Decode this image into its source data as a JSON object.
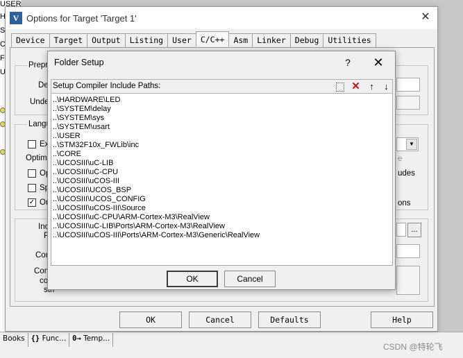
{
  "ide": {
    "project_fragment": "USER",
    "left_letters": [
      "H",
      "S",
      "C",
      "F",
      "U"
    ],
    "bottom_tabs": [
      {
        "icon": "",
        "label": "Books"
      },
      {
        "icon": "{}",
        "label": "Func..."
      },
      {
        "icon": "0→",
        "label": "Temp..."
      }
    ],
    "watermark": "CSDN @特轮飞"
  },
  "options_dialog": {
    "title": "Options for Target 'Target 1'",
    "tabs": [
      "Device",
      "Target",
      "Output",
      "Listing",
      "User",
      "C/C++",
      "Asm",
      "Linker",
      "Debug",
      "Utilities"
    ],
    "active_tab": "C/C++",
    "partial_labels": {
      "preprocessor": "Preproc",
      "define": "Def",
      "undefine": "Undef",
      "language": "Langu",
      "execute_only": "Ex",
      "optimization": "Optimiz",
      "opt1": "Op",
      "opt2": "Sp",
      "opt3": "On",
      "include": "Inclu",
      "paths": "Path",
      "misc": "M",
      "controls": "Contr",
      "compiler": "Comp",
      "control": "cont",
      "string": "stri",
      "right_e": "e",
      "right_udes": "udes",
      "right_ons": "ons"
    },
    "browse_button": "...",
    "buttons": {
      "ok": "OK",
      "cancel": "Cancel",
      "defaults": "Defaults",
      "help": "Help"
    }
  },
  "folder_setup": {
    "title": "Folder Setup",
    "help_symbol": "?",
    "close_symbol": "✕",
    "caption": "Setup Compiler Include Paths:",
    "tools": {
      "new": "",
      "delete": "✕",
      "up": "↑",
      "down": "↓"
    },
    "paths": [
      "..\\HARDWARE\\LED",
      "..\\SYSTEM\\delay",
      "..\\SYSTEM\\sys",
      "..\\SYSTEM\\usart",
      "..\\USER",
      "..\\STM32F10x_FWLib\\inc",
      "..\\CORE",
      "..\\UCOSIII\\uC-LIB",
      "..\\UCOSIII\\uC-CPU",
      "..\\UCOSIII\\uCOS-III",
      "..\\UCOSIII\\UCOS_BSP",
      "..\\UCOSIII\\UCOS_CONFIG",
      "..\\UCOSIII\\uCOS-III\\Source",
      "..\\UCOSIII\\uC-CPU\\ARM-Cortex-M3\\RealView",
      "..\\UCOSIII\\uC-LIB\\Ports\\ARM-Cortex-M3\\RealView",
      "..\\UCOSIII\\uCOS-III\\Ports\\ARM-Cortex-M3\\Generic\\RealView"
    ],
    "buttons": {
      "ok": "OK",
      "cancel": "Cancel"
    }
  }
}
